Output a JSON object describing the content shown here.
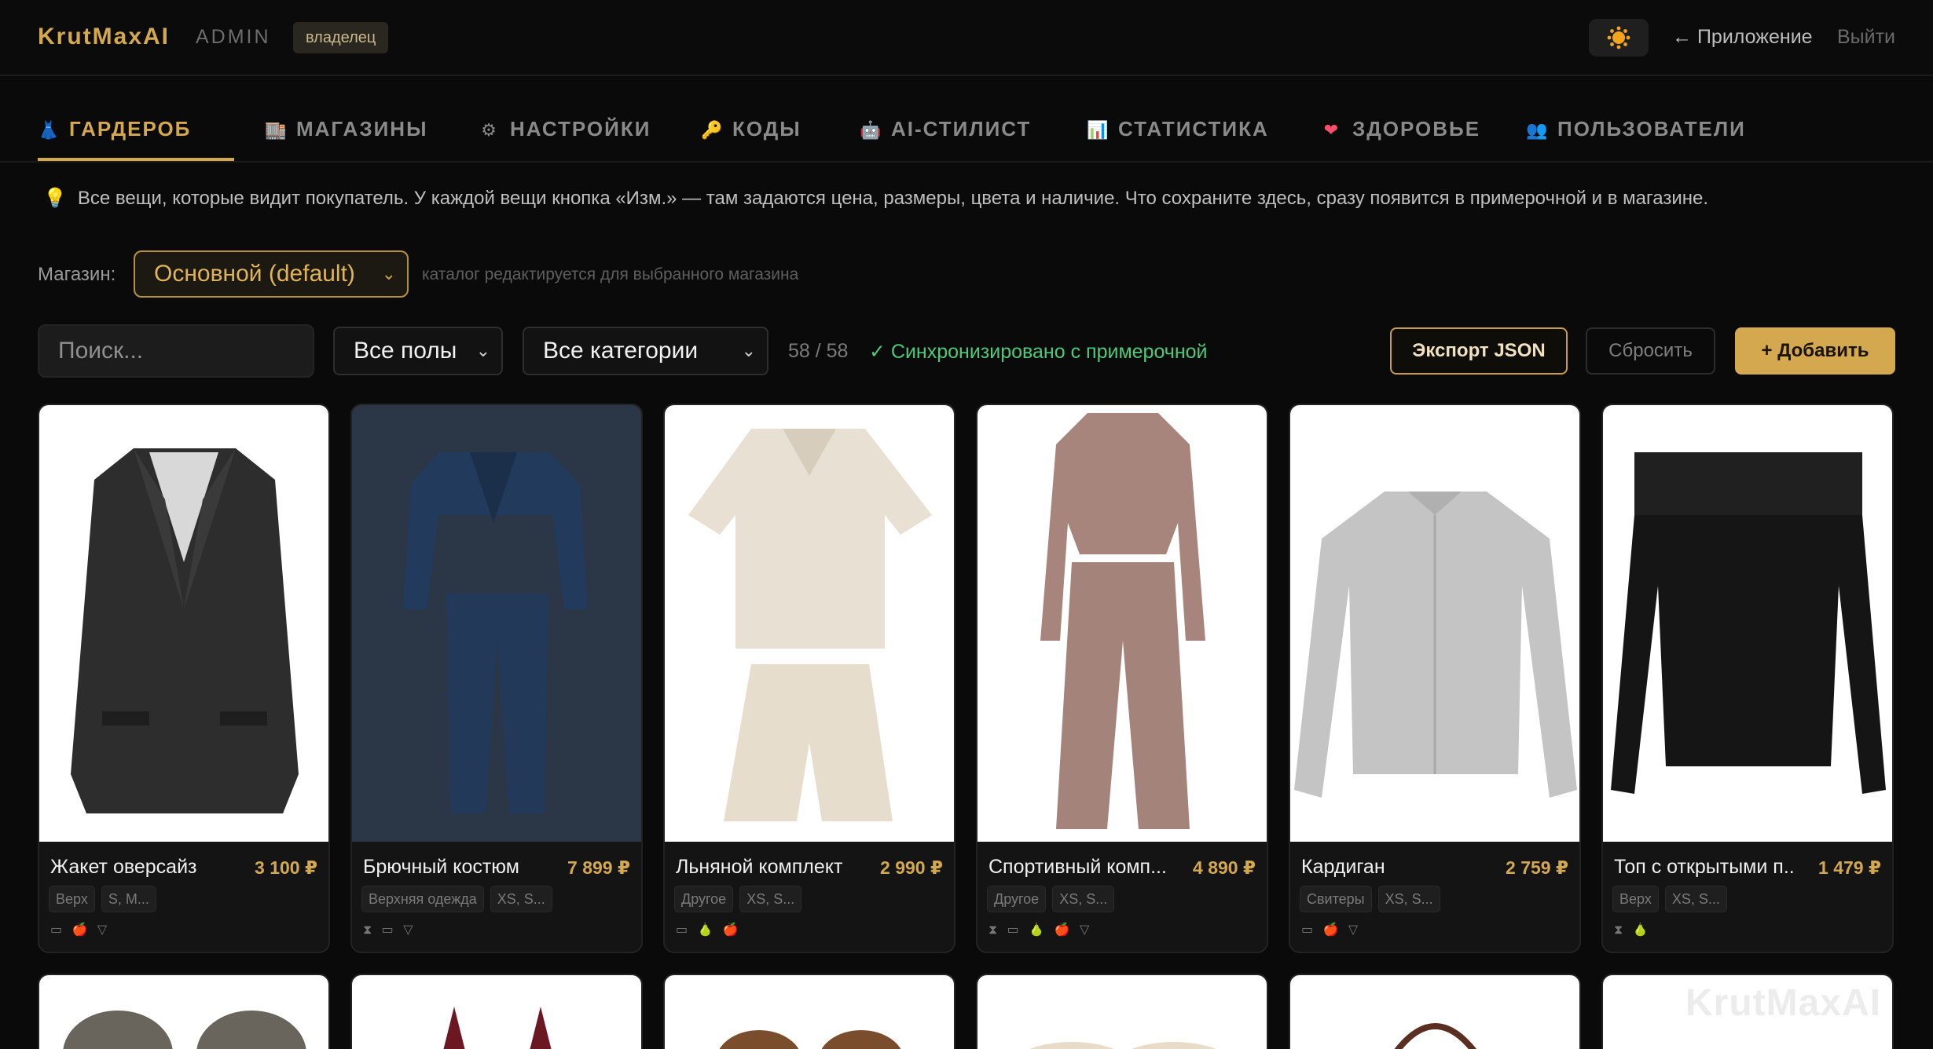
{
  "header": {
    "brand": "KrutMaxAI",
    "admin": "ADMIN",
    "role": "владелец",
    "app_link": "← Приложение",
    "logout": "Выйти"
  },
  "tabs": [
    {
      "icon": "👗",
      "label": "ГАРДЕРОБ",
      "active": true
    },
    {
      "icon": "🏬",
      "label": "МАГАЗИНЫ"
    },
    {
      "icon": "⚙",
      "label": "НАСТРОЙКИ"
    },
    {
      "icon": "🔑",
      "label": "КОДЫ"
    },
    {
      "icon": "🤖",
      "label": "AI-СТИЛИСТ"
    },
    {
      "icon": "📊",
      "label": "СТАТИСТИКА"
    },
    {
      "icon": "❤",
      "label": "ЗДОРОВЬЕ"
    },
    {
      "icon": "👥",
      "label": "ПОЛЬЗОВАТЕЛИ"
    }
  ],
  "info": {
    "icon": "💡",
    "text": "Все вещи, которые видит покупатель. У каждой вещи кнопка «Изм.» — там задаются цена, размеры, цвета и наличие. Что сохраните здесь, сразу появится в примерочной и в магазине."
  },
  "store": {
    "label": "Магазин:",
    "selected": "Основной (default)",
    "hint": "каталог редактируется для выбранного магазина"
  },
  "toolbar": {
    "search_placeholder": "Поиск...",
    "gender_select": "Все полы",
    "category_select": "Все категории",
    "count": "58 / 58",
    "sync": "✓ Синхронизировано с примерочной",
    "export": "Экспорт JSON",
    "reset": "Сбросить",
    "add": "+ Добавить"
  },
  "products": [
    {
      "name": "Жакет оверсайз",
      "price": "3 100 ₽",
      "tags": [
        "Верх",
        "S, M..."
      ],
      "icons": "▭ 🍎 ▽"
    },
    {
      "name": "Брючный костюм",
      "price": "7 899 ₽",
      "tags": [
        "Верхняя одежда",
        "XS, S..."
      ],
      "icons": "⧗ ▭ ▽"
    },
    {
      "name": "Льняной комплект",
      "price": "2 990 ₽",
      "tags": [
        "Другое",
        "XS, S..."
      ],
      "icons": "▭ 🍐 🍎"
    },
    {
      "name": "Спортивный комп...",
      "price": "4 890 ₽",
      "tags": [
        "Другое",
        "XS, S..."
      ],
      "icons": "⧗ ▭ 🍐 🍎 ▽"
    },
    {
      "name": "Кардиган",
      "price": "2 759 ₽",
      "tags": [
        "Свитеры",
        "XS, S..."
      ],
      "icons": "▭ 🍎 ▽"
    },
    {
      "name": "Топ с открытыми п...",
      "price": "1 479 ₽",
      "tags": [
        "Верх",
        "XS, S..."
      ],
      "icons": "⧗ 🍐"
    }
  ],
  "watermark": "KrutMaxAI",
  "colors": {
    "accent": "#d4a84e",
    "sync": "#4ec97a",
    "background": "#0a0a0a"
  }
}
